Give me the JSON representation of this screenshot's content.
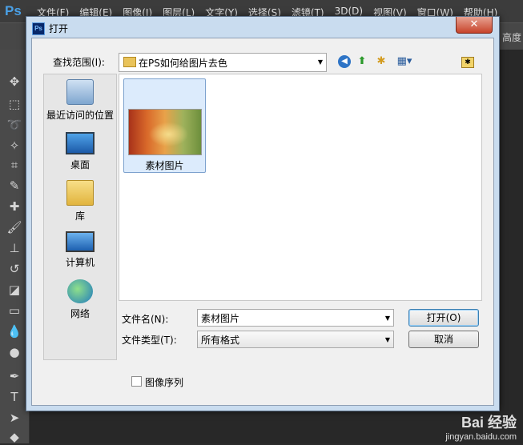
{
  "app": {
    "logo": "Ps",
    "menu": [
      "文件(F)",
      "编辑(E)",
      "图像(I)",
      "图层(L)",
      "文字(Y)",
      "选择(S)",
      "滤镜(T)",
      "3D(D)",
      "视图(V)",
      "窗口(W)",
      "帮助(H)"
    ],
    "right_label": "高度"
  },
  "dialog": {
    "title": "打开",
    "close": "✕",
    "lookin_label": "查找范围(I):",
    "lookin_value": "在PS如何给图片去色",
    "places": [
      {
        "label": "最近访问的位置",
        "icon": "recent-places-icon"
      },
      {
        "label": "桌面",
        "icon": "desktop-icon"
      },
      {
        "label": "库",
        "icon": "library-icon"
      },
      {
        "label": "计算机",
        "icon": "computer-icon"
      },
      {
        "label": "网络",
        "icon": "network-icon"
      }
    ],
    "files": [
      {
        "name": "素材图片",
        "selected": true
      }
    ],
    "filename_label": "文件名(N):",
    "filename_value": "素材图片",
    "filetype_label": "文件类型(T):",
    "filetype_value": "所有格式",
    "open_button": "打开(O)",
    "cancel_button": "取消",
    "checkbox_label": "图像序列",
    "checkbox_checked": false
  },
  "watermark": {
    "main": "Bai 经验",
    "url": "jingyan.baidu.com"
  }
}
